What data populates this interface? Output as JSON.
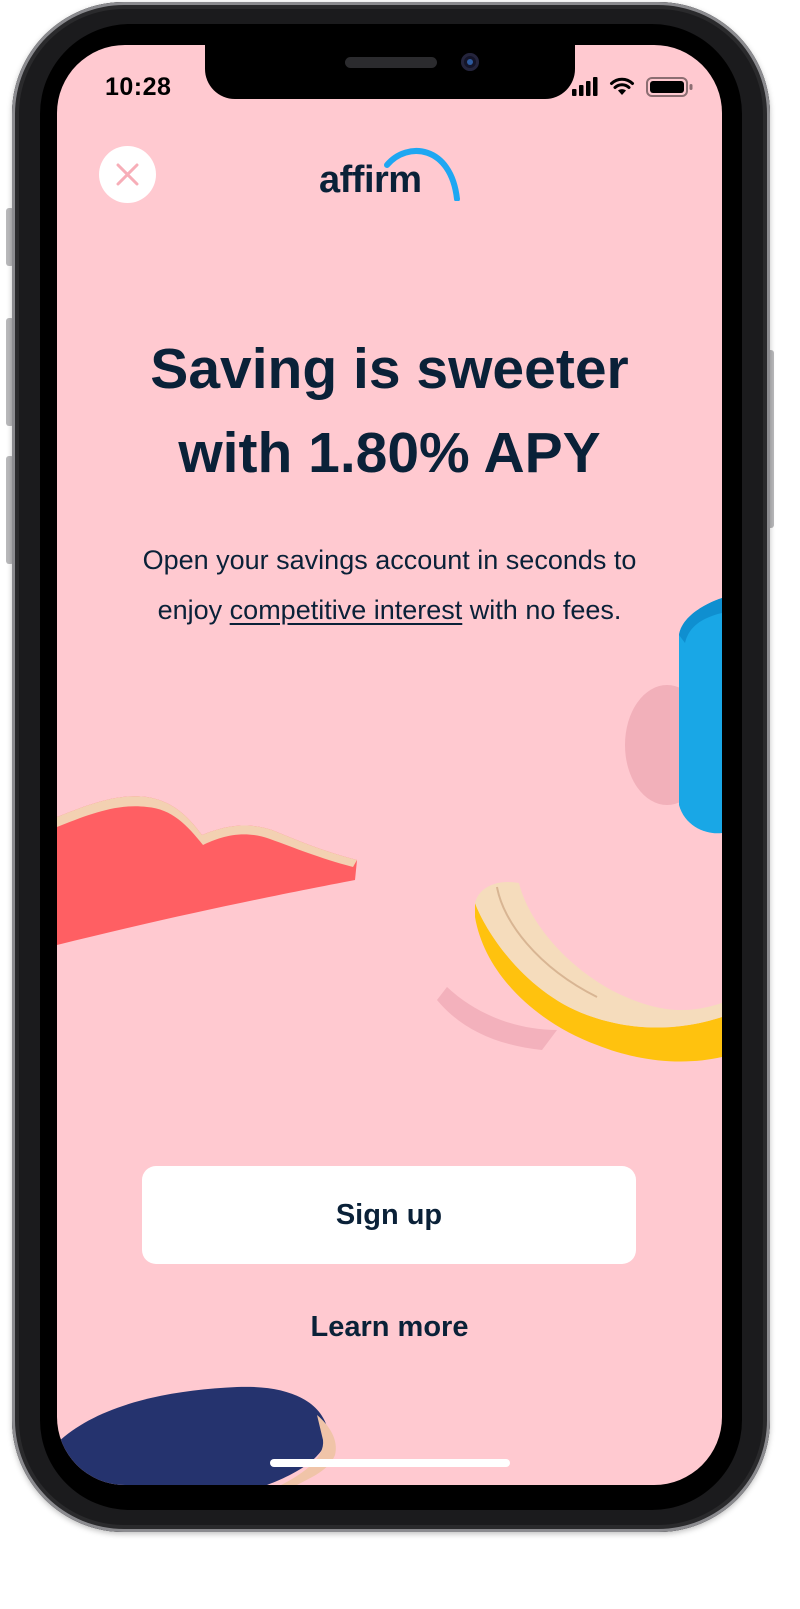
{
  "status_bar": {
    "time": "10:28",
    "icons": [
      "cellular-signal-icon",
      "wifi-icon",
      "battery-icon"
    ]
  },
  "header": {
    "close_icon": "close-icon",
    "logo_text": "affirm"
  },
  "main": {
    "headline_line1": "Saving is sweeter",
    "headline_line2": "with 1.80% APY",
    "subtext_part1": "Open your savings account in seconds to",
    "subtext_part2": "enjoy",
    "subtext_link": "competitive interest",
    "subtext_part3": "with no fees."
  },
  "actions": {
    "signup_label": "Sign up",
    "learn_more_label": "Learn more"
  },
  "colors": {
    "background": "#ffc9d0",
    "text": "#0a2138",
    "logo_accent": "#1ea7f2",
    "shape_coral": "#ff5f63",
    "shape_yellow": "#ffc20e",
    "shape_blue": "#19a7e6",
    "shape_navy": "#25336e"
  }
}
